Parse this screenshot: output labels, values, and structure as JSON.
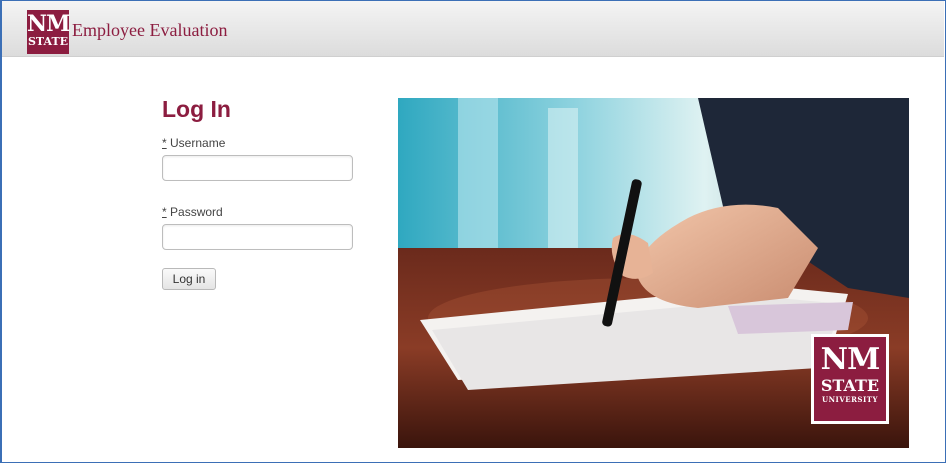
{
  "header": {
    "logo": {
      "line1": "NM",
      "line2": "STATE"
    },
    "title": "Employee Evaluation"
  },
  "login": {
    "heading": "Log In",
    "username": {
      "required_mark": "*",
      "label": "Username",
      "value": "",
      "placeholder": ""
    },
    "password": {
      "required_mark": "*",
      "label": "Password",
      "value": "",
      "placeholder": ""
    },
    "submit_label": "Log in"
  },
  "photo": {
    "icon": "hand-signing-document-image",
    "badge": {
      "line1": "NM",
      "line2": "STATE",
      "line3": "UNIVERSITY"
    }
  },
  "colors": {
    "brand": "#8c1d40",
    "header_bg": "#e4e4e4",
    "frame_border": "#3b6fb6"
  }
}
